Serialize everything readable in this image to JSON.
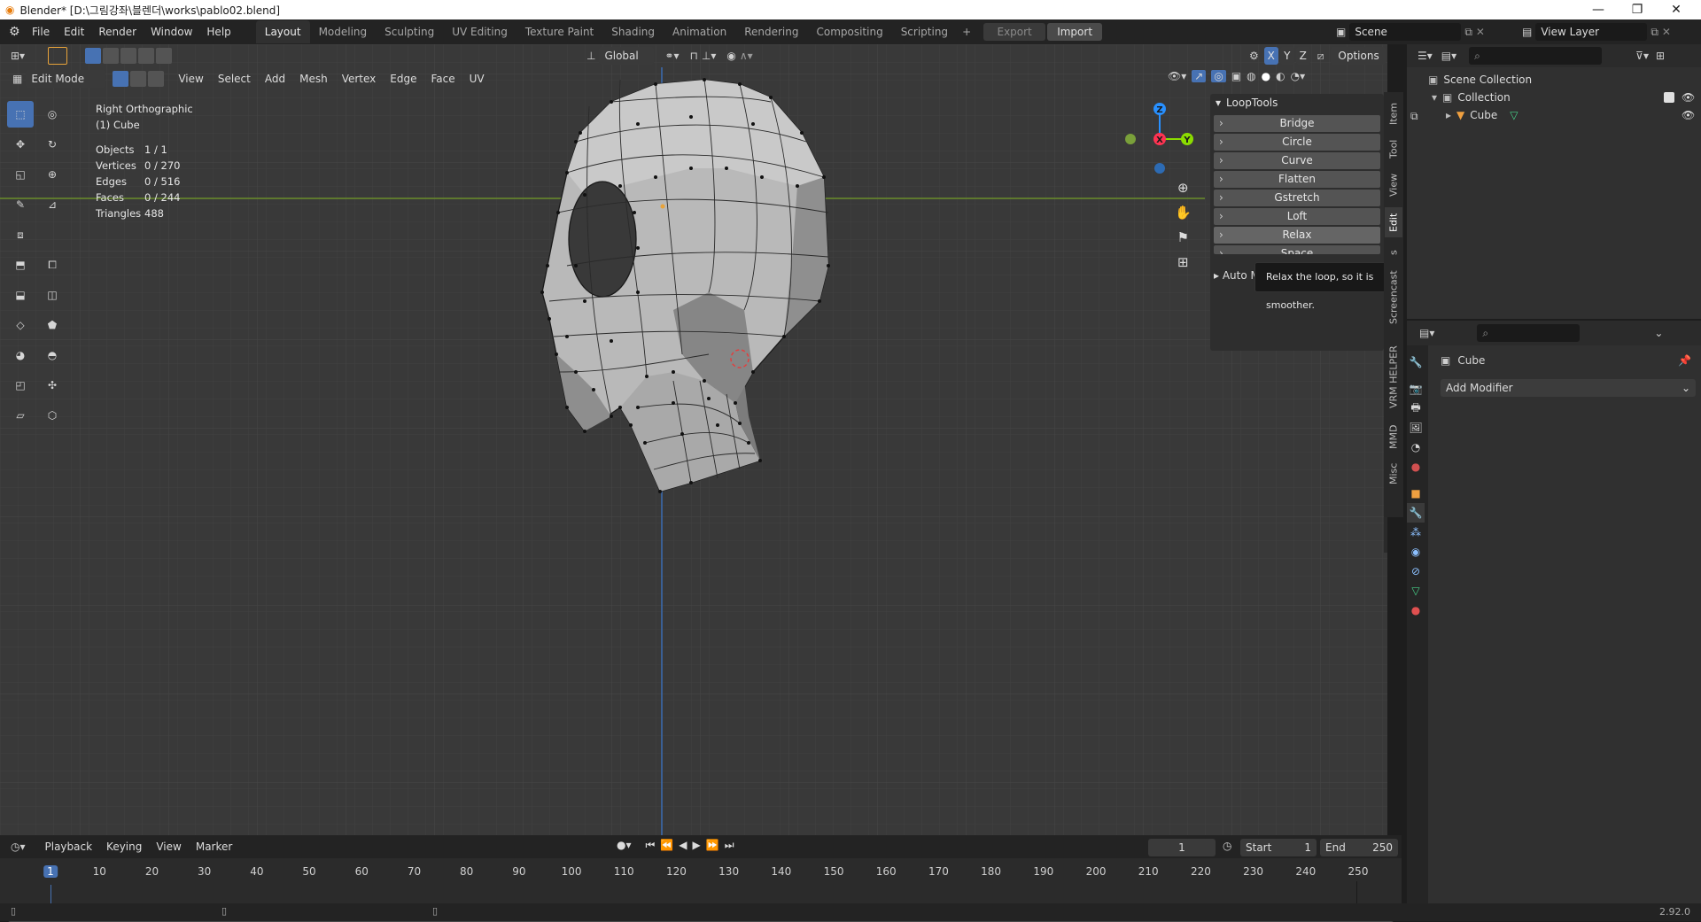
{
  "window": {
    "title": "Blender* [D:\\그림강좌\\블렌더\\works\\pablo02.blend]",
    "controls": [
      "—",
      "❐",
      "✕"
    ]
  },
  "topbar": {
    "menus": [
      "File",
      "Edit",
      "Render",
      "Window",
      "Help"
    ],
    "workspaces": [
      "Layout",
      "Modeling",
      "Sculpting",
      "UV Editing",
      "Texture Paint",
      "Shading",
      "Animation",
      "Rendering",
      "Compositing",
      "Scripting"
    ],
    "active_workspace": "Layout",
    "add_tab": "+",
    "export_label": "Export",
    "import_label": "Import",
    "scene": "Scene",
    "view_layer": "View Layer"
  },
  "viewport_header": {
    "transform_orientation": "Global",
    "options_label": "Options",
    "axes": [
      "X",
      "Y",
      "Z"
    ],
    "mode": "Edit Mode",
    "menus": [
      "View",
      "Select",
      "Add",
      "Mesh",
      "Vertex",
      "Edge",
      "Face",
      "UV"
    ]
  },
  "viewport": {
    "view_name": "Right Orthographic",
    "object_name": "(1) Cube",
    "stats": [
      {
        "label": "Objects",
        "value": "1 / 1"
      },
      {
        "label": "Vertices",
        "value": "0 / 270"
      },
      {
        "label": "Edges",
        "value": "0 / 516"
      },
      {
        "label": "Faces",
        "value": "0 / 244"
      },
      {
        "label": "Triangles",
        "value": "488"
      }
    ],
    "gizmo": {
      "z": "Z",
      "x": "X",
      "y": "Y"
    }
  },
  "looptools": {
    "title": "LoopTools",
    "items": [
      "Bridge",
      "Circle",
      "Curve",
      "Flatten",
      "Gstretch",
      "Loft",
      "Relax",
      "Space"
    ],
    "auto_label": "Auto M",
    "tooltip": "Relax the loop, so it is smoother."
  },
  "sidebar_tabs": [
    "Item",
    "Tool",
    "View",
    "Edit",
    "s",
    "Screencast",
    "VRM HELPER",
    "MMD",
    "Misc"
  ],
  "outliner": {
    "scene_collection": "Scene Collection",
    "collection": "Collection",
    "object": "Cube"
  },
  "properties": {
    "object_name": "Cube",
    "add_modifier": "Add Modifier"
  },
  "timeline": {
    "menus": [
      "Playback",
      "Keying",
      "View",
      "Marker"
    ],
    "current_frame": "1",
    "start_label": "Start",
    "start_value": "1",
    "end_label": "End",
    "end_value": "250",
    "ticks": [
      "1",
      "10",
      "20",
      "30",
      "40",
      "50",
      "60",
      "70",
      "80",
      "90",
      "100",
      "110",
      "120",
      "130",
      "140",
      "150",
      "160",
      "170",
      "180",
      "190",
      "200",
      "210",
      "220",
      "230",
      "240",
      "250"
    ]
  },
  "statusbar": {
    "version": "2.92.0"
  },
  "colors": {
    "accent": "#4772b3",
    "x_axis": "#ff3352",
    "y_axis": "#8bdc00",
    "z_axis": "#2890ff",
    "viewport_bg": "#393939"
  }
}
